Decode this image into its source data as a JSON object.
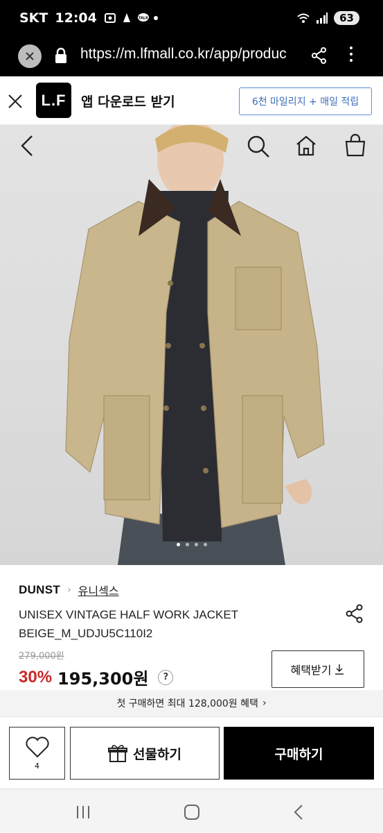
{
  "status_bar": {
    "carrier": "SKT",
    "time": "12:04",
    "battery": "63"
  },
  "browser": {
    "url": "https://m.lfmall.co.kr/app/produc"
  },
  "app_banner": {
    "logo_text": "L.F",
    "text": "앱 다운로드 받기",
    "cta": "6천 마일리지 + 매일 적립"
  },
  "product": {
    "brand": "DUNST",
    "category": "유니섹스",
    "name": "UNISEX VINTAGE HALF WORK JACKET BEIGE_M_UDJU5C110I2",
    "original_price": "279,000원",
    "discount": "30%",
    "price": "195,300원",
    "help": "?",
    "benefit_button": "혜택받기",
    "images_total": 4,
    "current_image": 1
  },
  "promo": {
    "text": "첫 구매하면 최대 128,000원 혜택",
    "arrow": "›"
  },
  "actions": {
    "like_count": "4",
    "gift_label": "선물하기",
    "buy_label": "구매하기"
  },
  "colors": {
    "discount": "#c92a2a",
    "cta_border": "#5b8fd6",
    "buy_bg": "#000000",
    "jacket": "#c9b68c"
  }
}
